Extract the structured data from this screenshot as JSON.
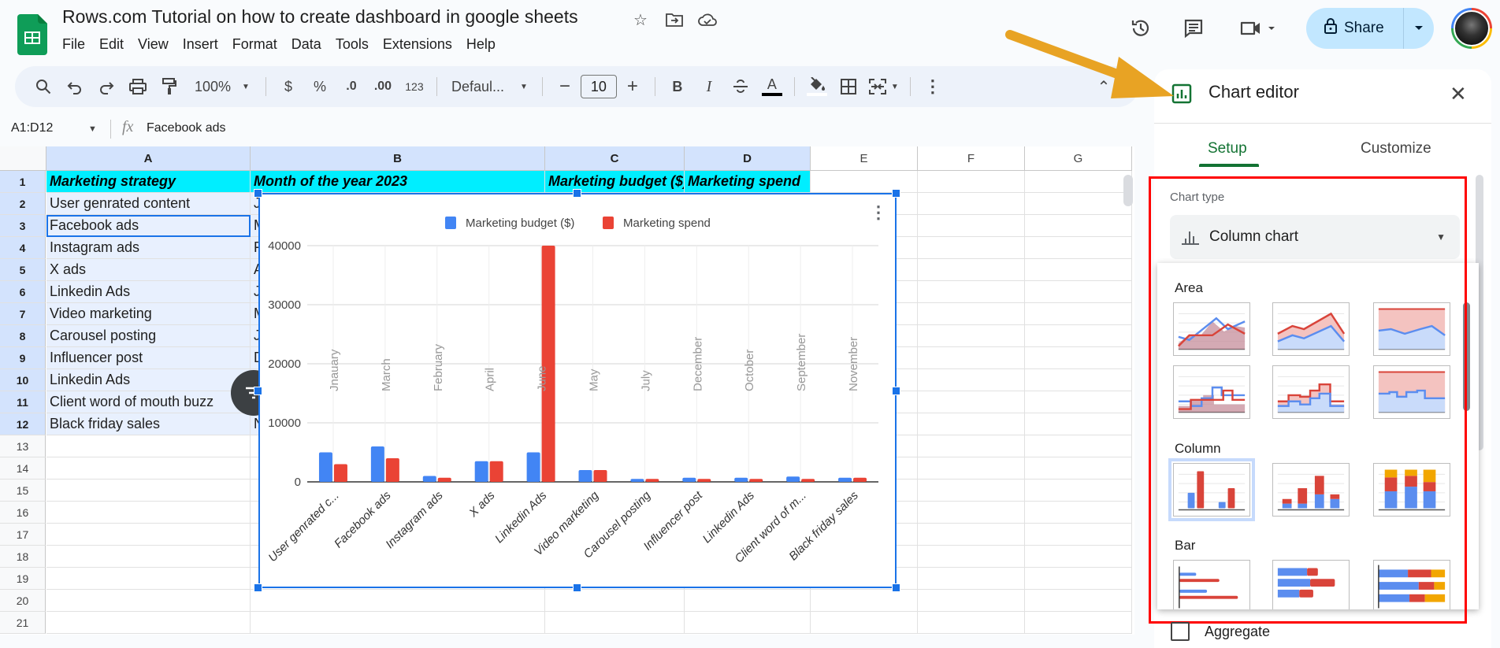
{
  "app": {
    "title": "Rows.com Tutorial on how to create dashboard in google sheets",
    "menu": [
      "File",
      "Edit",
      "View",
      "Insert",
      "Format",
      "Data",
      "Tools",
      "Extensions",
      "Help"
    ],
    "share_label": "Share"
  },
  "toolbar": {
    "zoom": "100%",
    "currency": "$",
    "percent": "%",
    "decrease_decimal": ".0",
    "increase_decimal": ".00",
    "number_format": "123",
    "font": "Defaul...",
    "font_size": "10",
    "bold": "B",
    "italic": "I",
    "text_color": "A"
  },
  "formula_bar": {
    "name_box": "A1:D12",
    "fx": "fx",
    "content": "Facebook ads"
  },
  "sheet": {
    "columns": [
      "A",
      "B",
      "C",
      "D",
      "E",
      "F",
      "G"
    ],
    "row_numbers": [
      "1",
      "2",
      "3",
      "4",
      "5",
      "6",
      "7",
      "8",
      "9",
      "10",
      "11",
      "12",
      "13",
      "14",
      "15",
      "16",
      "17",
      "18",
      "19",
      "20",
      "21"
    ],
    "headers": [
      "Marketing strategy",
      "Month of the year 2023",
      "Marketing budget ($)",
      "Marketing spend"
    ],
    "col_a": [
      "User genrated content",
      "Facebook ads",
      "Instagram ads",
      "X ads",
      "Linkedin Ads",
      "Video marketing",
      "Carousel posting",
      "Influencer post",
      "Linkedin Ads",
      "Client word of mouth buzz",
      "Black friday sales"
    ],
    "col_b_visible": [
      "J",
      "M",
      "F",
      "A",
      "J",
      "M",
      "J",
      "D",
      "",
      "",
      "N"
    ]
  },
  "chart_data": {
    "type": "bar",
    "title": "",
    "categories": [
      "User genrated c...",
      "Facebook ads",
      "Instagram ads",
      "X ads",
      "Linkedin Ads",
      "Video marketing",
      "Carousel posting",
      "Influencer post",
      "Linkedin Ads",
      "Client word of m...",
      "Black friday sales"
    ],
    "month_annotations": [
      "Jnauary",
      "March",
      "February",
      "April",
      "June",
      "May",
      "July",
      "December",
      "October",
      "September",
      "November"
    ],
    "series": [
      {
        "name": "Marketing budget ($)",
        "color": "#4285f4",
        "values": [
          5000,
          6000,
          1000,
          3500,
          5000,
          2000,
          500,
          700,
          700,
          900,
          700
        ]
      },
      {
        "name": "Marketing spend",
        "color": "#ea4335",
        "values": [
          3000,
          4000,
          700,
          3500,
          40000,
          2000,
          500,
          500,
          500,
          500,
          700
        ]
      }
    ],
    "yticks": [
      "0",
      "10000",
      "20000",
      "30000",
      "40000"
    ],
    "ylim": [
      0,
      40000
    ],
    "xlabel": "",
    "ylabel": "",
    "grid": true,
    "legend": "top"
  },
  "editor": {
    "title": "Chart editor",
    "tabs": [
      "Setup",
      "Customize"
    ],
    "active_tab": "Setup",
    "chart_type_label": "Chart type",
    "chart_type_value": "Column chart",
    "sections": [
      "Area",
      "Column",
      "Bar"
    ],
    "aggregate_label": "Aggregate",
    "aggregate_checked": false
  },
  "colors": {
    "header_fill": "#00eeff",
    "selection": "#1a73e8",
    "accent_green": "#137333",
    "highlight_box": "#ff0000",
    "arrow": "#e8a324"
  }
}
